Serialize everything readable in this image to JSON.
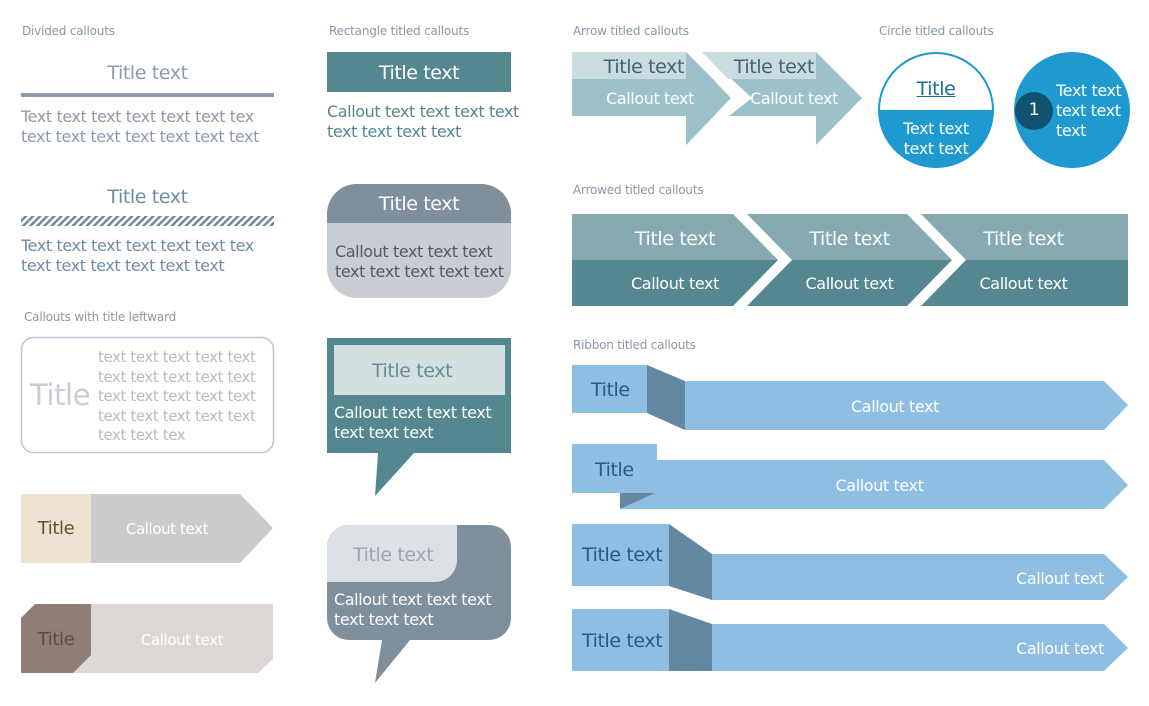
{
  "sections": {
    "divided": "Divided callouts",
    "rectangle": "Rectangle titled callouts",
    "arrow": "Arrow titled callouts",
    "circle": "Circle titled callouts",
    "arrowed": "Arrowed titled callouts",
    "leftward": "Callouts with title leftward",
    "ribbon": "Ribbon titled callouts"
  },
  "divided": [
    {
      "title": "Title text",
      "line1": "Text text text text text text tex",
      "line2": "text text text text text text text"
    },
    {
      "title": "Title text",
      "line1": "Text text text text text text tex",
      "line2": "text text text text text text"
    }
  ],
  "leftward": {
    "box": {
      "title": "Title",
      "lines": [
        "text text text text text",
        "text text text text text",
        "text text text text text",
        "text text text text text",
        "text text tex"
      ]
    },
    "tag1": {
      "title": "Title",
      "callout": "Callout text"
    },
    "tag2": {
      "title": "Title",
      "callout": "Callout text"
    }
  },
  "rectangle": [
    {
      "title": "Title text",
      "line1": "Callout text text text text",
      "line2": "text text text text"
    },
    {
      "title": "Title text",
      "line1": "Callout text text text",
      "line2": "text text text text text"
    },
    {
      "title": "Title text",
      "line1": "Callout text text text",
      "line2": "text text text"
    },
    {
      "title": "Title text",
      "line1": "Callout text text text",
      "line2": "text text text"
    }
  ],
  "arrow": [
    {
      "title": "Title text",
      "callout": "Callout text"
    },
    {
      "title": "Title text",
      "callout": "Callout text"
    }
  ],
  "circle": [
    {
      "title": "Title",
      "line1": "Text text",
      "line2": "text text"
    },
    {
      "number": "1",
      "line1": "Text text",
      "line2": "text text",
      "line3": "text"
    }
  ],
  "arrowed": [
    {
      "title": "Title text",
      "callout": "Callout text"
    },
    {
      "title": "Title text",
      "callout": "Callout text"
    },
    {
      "title": "Title text",
      "callout": "Callout text"
    }
  ],
  "ribbon": [
    {
      "title": "Title",
      "callout": "Callout text"
    },
    {
      "title": "Title",
      "callout": "Callout text"
    },
    {
      "title": "Title text",
      "callout": "Callout text"
    },
    {
      "title": "Title text",
      "callout": "Callout text"
    }
  ],
  "colors": {
    "teal": "#558791",
    "teal_light": "#87a9b1",
    "arrow_light": "#9cc1c9",
    "arrow_title_band": "#c9dde1",
    "slate": "#808f9c",
    "slate_light": "#c7cdd3",
    "circle_blue": "#1e9ad0",
    "circle_dark": "#0f5370",
    "ribbon": "#8ebee2",
    "ribbon_fold": "#6487a2",
    "beige": "#ede2d2",
    "gray_band": "#cbcbcb",
    "taupe": "#8f7e75",
    "taupe_light": "#ddd8d5"
  }
}
